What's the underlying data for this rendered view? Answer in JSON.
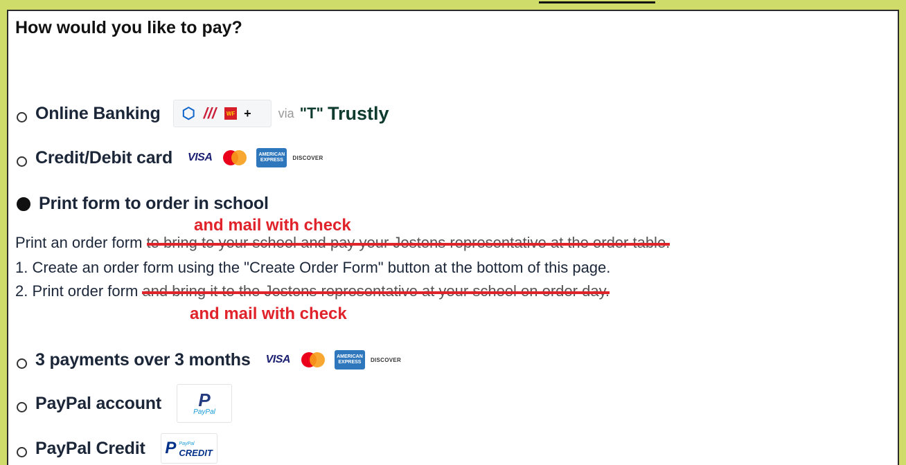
{
  "heading": "How would you like to pay?",
  "options": [
    {
      "label": "Online Banking",
      "selected": false,
      "logos": {
        "chase": "chase-icon",
        "boa": "bank-of-america-icon",
        "wf_text": "WF",
        "plus": "+",
        "via": "via",
        "trustly": "Trustly"
      }
    },
    {
      "label": "Credit/Debit card",
      "selected": false
    },
    {
      "label": "Print form to order in school",
      "selected": true
    },
    {
      "label": "3 payments over 3 months",
      "selected": false
    },
    {
      "label": "PayPal account",
      "selected": false
    },
    {
      "label": "PayPal Credit",
      "selected": false
    }
  ],
  "cards": {
    "visa": "VISA",
    "amex": "AMERICAN EXPRESS",
    "discover": "DISCOVER"
  },
  "paypal": {
    "word": "PayPal",
    "credit_small": "PayPal",
    "credit": "CREDIT"
  },
  "description": {
    "line1_prefix": "Print an order form ",
    "line1_struck": "to bring to your school and pay your Jostens representative at the order table.",
    "line2": "1. Create an order form using the \"Create Order Form\" button at the bottom of this page.",
    "line3_prefix": "2. Print order form ",
    "line3_struck": "and bring it to the Jostens representative at your school on order day."
  },
  "annotations": {
    "top": "and mail with check",
    "bottom": "and mail with check"
  },
  "colors": {
    "background": "#cfdc6a",
    "annotation": "#e0232a",
    "text": "#1b2638"
  }
}
